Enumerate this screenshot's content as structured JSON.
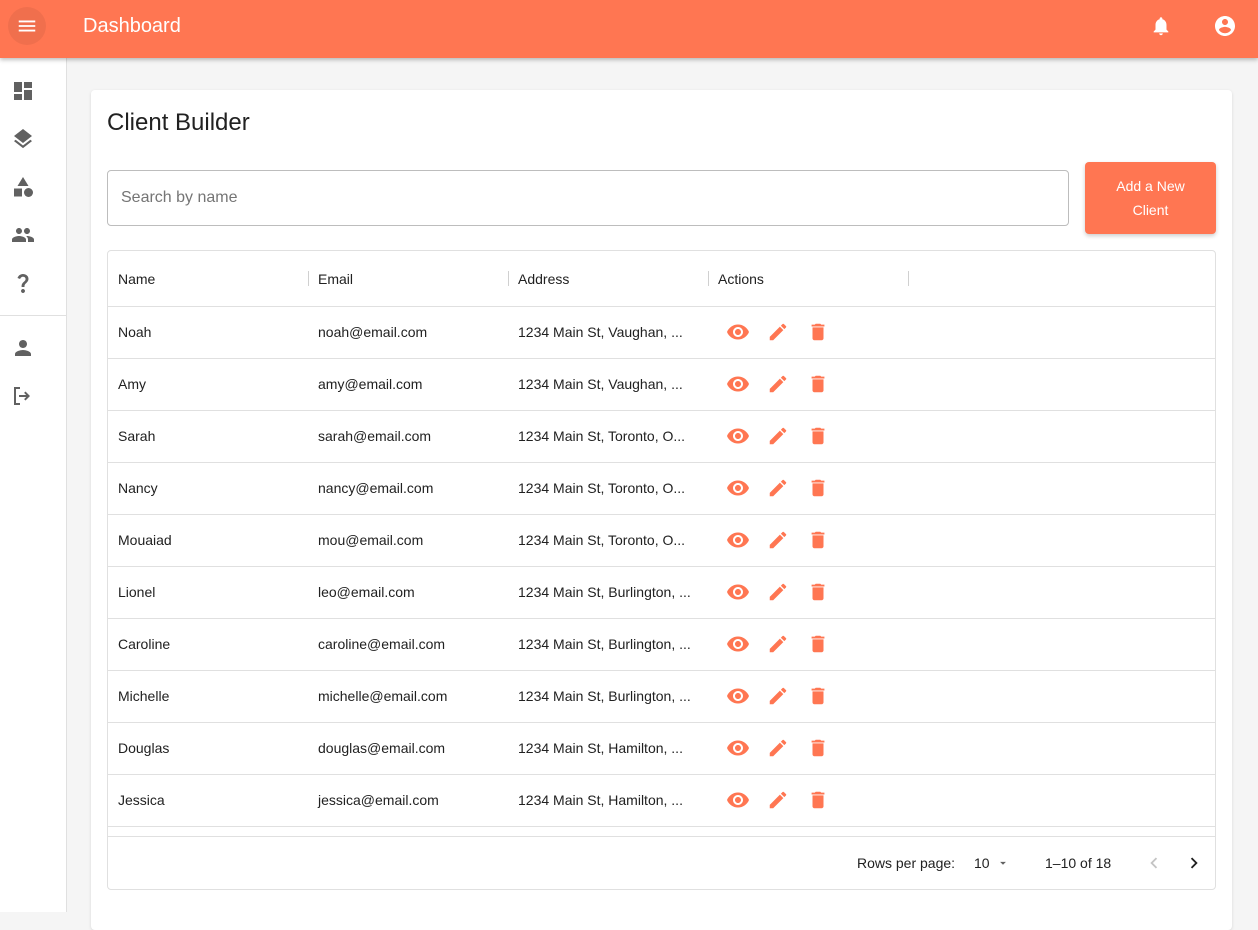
{
  "theme": {
    "accent": "#ff7652",
    "icon_gray": "#616161"
  },
  "header": {
    "title": "Dashboard",
    "icons": [
      "menu-icon",
      "bell-icon",
      "account-circle-icon"
    ]
  },
  "sidebar": {
    "icons": [
      "dashboard-icon",
      "layers-icon",
      "category-icon",
      "people-icon",
      "help-icon",
      "person-icon",
      "logout-icon"
    ]
  },
  "page": {
    "title": "Client Builder",
    "search_placeholder": "Search by name",
    "add_button_label": "Add a New Client"
  },
  "table": {
    "columns": [
      "Name",
      "Email",
      "Address",
      "Actions"
    ],
    "rows": [
      {
        "name": "Noah",
        "email": "noah@email.com",
        "address": "1234 Main St, Vaughan, ..."
      },
      {
        "name": "Amy",
        "email": "amy@email.com",
        "address": "1234 Main St, Vaughan, ..."
      },
      {
        "name": "Sarah",
        "email": "sarah@email.com",
        "address": "1234 Main St, Toronto, O..."
      },
      {
        "name": "Nancy",
        "email": "nancy@email.com",
        "address": "1234 Main St, Toronto, O..."
      },
      {
        "name": "Mouaiad",
        "email": "mou@email.com",
        "address": "1234 Main St, Toronto, O..."
      },
      {
        "name": "Lionel",
        "email": "leo@email.com",
        "address": "1234 Main St, Burlington, ..."
      },
      {
        "name": "Caroline",
        "email": "caroline@email.com",
        "address": "1234 Main St, Burlington, ..."
      },
      {
        "name": "Michelle",
        "email": "michelle@email.com",
        "address": "1234 Main St, Burlington, ..."
      },
      {
        "name": "Douglas",
        "email": "douglas@email.com",
        "address": "1234 Main St, Hamilton, ..."
      },
      {
        "name": "Jessica",
        "email": "jessica@email.com",
        "address": "1234 Main St, Hamilton, ..."
      }
    ],
    "row_action_icons": [
      "eye-icon",
      "pencil-icon",
      "trash-icon"
    ]
  },
  "pagination": {
    "rows_per_page_label": "Rows per page:",
    "rows_per_page_value": "10",
    "range_label": "1–10 of 18"
  }
}
